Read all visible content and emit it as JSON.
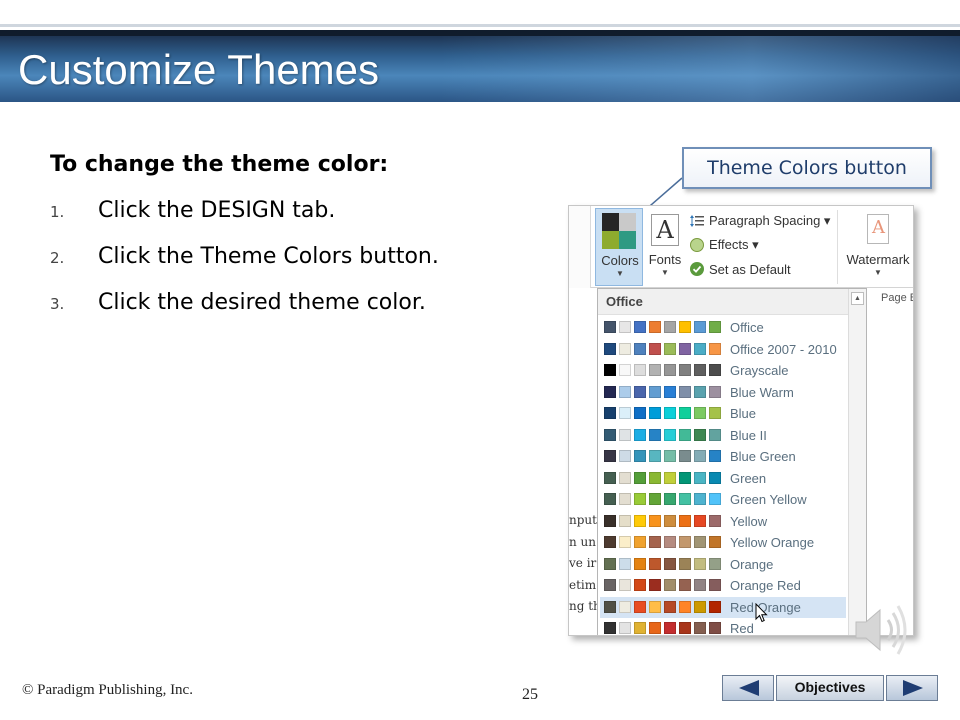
{
  "slide": {
    "title": "Customize Themes",
    "page_number": "25",
    "copyright": "© Paradigm Publishing, Inc."
  },
  "instructions": {
    "heading": "To change the theme color:",
    "steps": [
      {
        "num": "1.",
        "text": "Click the DESIGN tab."
      },
      {
        "num": "2.",
        "text": "Click the Theme Colors button."
      },
      {
        "num": "3.",
        "text": "Click the desired theme color."
      }
    ]
  },
  "callout": {
    "label": "Theme Colors button"
  },
  "ribbon": {
    "colors_label": "Colors",
    "fonts_label": "Fonts",
    "fonts_glyph": "A",
    "paragraph_spacing": "Paragraph Spacing ▾",
    "effects": "Effects ▾",
    "set_as_default": "Set as Default",
    "watermark": "Watermark",
    "page_partial": "Page B"
  },
  "dropdown": {
    "header": "Office",
    "hover_item": "Red Orange",
    "themes": [
      {
        "name": "Office",
        "colors": [
          "#44546a",
          "#e7e6e6",
          "#4472c4",
          "#ed7d31",
          "#a5a5a5",
          "#ffc000",
          "#5b9bd5",
          "#70ad47"
        ]
      },
      {
        "name": "Office 2007 - 2010",
        "colors": [
          "#1f497d",
          "#eeece1",
          "#4f81bd",
          "#c0504d",
          "#9bbb59",
          "#8064a2",
          "#4bacc6",
          "#f79646"
        ]
      },
      {
        "name": "Grayscale",
        "colors": [
          "#000000",
          "#f8f8f8",
          "#dddddd",
          "#b2b2b2",
          "#969696",
          "#808080",
          "#5f5f5f",
          "#4d4d4d"
        ]
      },
      {
        "name": "Blue Warm",
        "colors": [
          "#242852",
          "#acccea",
          "#4a66ac",
          "#629dd1",
          "#297fd5",
          "#7f8fa9",
          "#5aa2ae",
          "#9d90a0"
        ]
      },
      {
        "name": "Blue",
        "colors": [
          "#17406d",
          "#dbeff9",
          "#0f6fc6",
          "#009dd9",
          "#0bd0d9",
          "#10cf9b",
          "#7cca62",
          "#a5c249"
        ]
      },
      {
        "name": "Blue II",
        "colors": [
          "#335b74",
          "#dfe3e5",
          "#1cade4",
          "#2683c6",
          "#27ced7",
          "#42ba97",
          "#3e8853",
          "#62a39f"
        ]
      },
      {
        "name": "Blue Green",
        "colors": [
          "#373545",
          "#cedbe6",
          "#3494ba",
          "#58b6c0",
          "#75bda7",
          "#7a8c8e",
          "#84acb6",
          "#2683c6"
        ]
      },
      {
        "name": "Green",
        "colors": [
          "#455f51",
          "#e3ded1",
          "#549e39",
          "#8ab833",
          "#c0cf3a",
          "#029676",
          "#4ab5c4",
          "#0989b1"
        ]
      },
      {
        "name": "Green Yellow",
        "colors": [
          "#455f51",
          "#e3ded1",
          "#99cb38",
          "#63a537",
          "#37a76f",
          "#44c1a3",
          "#4eb3cf",
          "#51c3f9"
        ]
      },
      {
        "name": "Yellow",
        "colors": [
          "#39302a",
          "#e5dec9",
          "#ffca08",
          "#f8931d",
          "#ce8d3e",
          "#ec7016",
          "#e64823",
          "#9c6a6a"
        ]
      },
      {
        "name": "Yellow Orange",
        "colors": [
          "#4e3b30",
          "#fbeec9",
          "#f0a22e",
          "#a5644e",
          "#b58b80",
          "#c3986d",
          "#a19574",
          "#c17529"
        ]
      },
      {
        "name": "Orange",
        "colors": [
          "#637052",
          "#ccddea",
          "#e48312",
          "#bd582c",
          "#865640",
          "#9b8357",
          "#c2bc80",
          "#94a088"
        ]
      },
      {
        "name": "Orange Red",
        "colors": [
          "#696464",
          "#e9e5dc",
          "#d34817",
          "#9b2d1f",
          "#a28e6a",
          "#956251",
          "#918485",
          "#855d5d"
        ]
      },
      {
        "name": "Red Orange",
        "colors": [
          "#505046",
          "#eeece1",
          "#e84c22",
          "#ffbd47",
          "#b64926",
          "#ff8427",
          "#cc9900",
          "#b22600"
        ]
      },
      {
        "name": "Red",
        "colors": [
          "#323232",
          "#e3e3e3",
          "#e0b232",
          "#e76618",
          "#c32d2e",
          "#a8351a",
          "#845e4f",
          "#7f4d45"
        ]
      }
    ]
  },
  "doc_fragments": [
    "nput",
    "n un",
    "ve ir",
    "etim",
    "ng th"
  ],
  "navigation": {
    "objectives_label": "Objectives",
    "prev_icon": "left-triangle-icon",
    "next_icon": "right-triangle-icon"
  },
  "icons": {
    "speaker": "speaker-icon",
    "cursor": "mouse-pointer-icon"
  }
}
